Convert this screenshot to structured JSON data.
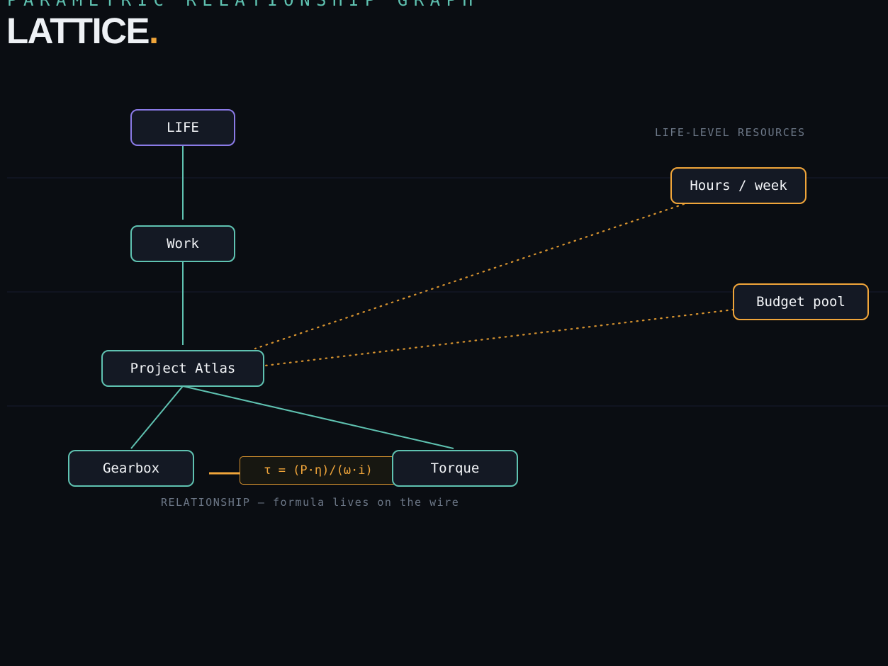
{
  "header": {
    "eyebrow": "PARAMETRIC RELATIONSHIP GRAPH",
    "brand": "LATTICE",
    "brand_dot": "."
  },
  "colors": {
    "background": "#0a0d12",
    "node_border": "#5fc2b1",
    "root_border": "#8a7ae6",
    "resource_border": "#f0a53a",
    "formula": "#f0a53a",
    "caption": "#6c7787"
  },
  "hierarchy": {
    "root": {
      "label": "LIFE"
    },
    "domain": {
      "label": "Work"
    },
    "project": {
      "label": "Project Atlas"
    },
    "components": [
      {
        "label": "Gearbox"
      },
      {
        "label": "Torque"
      }
    ]
  },
  "resources": {
    "section_label": "LIFE-LEVEL RESOURCES",
    "items": [
      {
        "label": "Hours / week"
      },
      {
        "label": "Budget pool"
      }
    ]
  },
  "relationship": {
    "formula": "τ = (P·η)/(ω·i)",
    "caption": "RELATIONSHIP — formula lives on the wire"
  },
  "edges": [
    {
      "from": "LIFE",
      "to": "Work",
      "style": "solid"
    },
    {
      "from": "Work",
      "to": "Project Atlas",
      "style": "solid"
    },
    {
      "from": "Project Atlas",
      "to": "Gearbox",
      "style": "solid"
    },
    {
      "from": "Project Atlas",
      "to": "Torque",
      "style": "solid"
    },
    {
      "from": "Hours / week",
      "to": "Project Atlas",
      "style": "dotted"
    },
    {
      "from": "Budget pool",
      "to": "Project Atlas",
      "style": "dotted"
    },
    {
      "from": "Gearbox",
      "to": "Torque",
      "style": "formula"
    }
  ]
}
